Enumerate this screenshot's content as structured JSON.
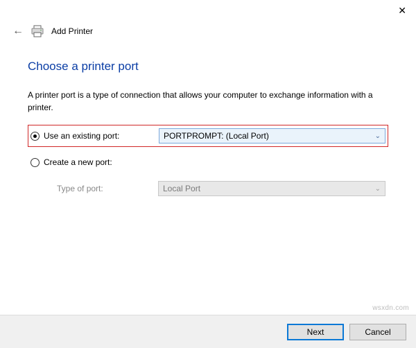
{
  "window": {
    "close_symbol": "✕"
  },
  "header": {
    "back_symbol": "←",
    "title": "Add Printer"
  },
  "content": {
    "heading": "Choose a printer port",
    "description": "A printer port is a type of connection that allows your computer to exchange information with a printer."
  },
  "options": {
    "existing": {
      "label": "Use an existing port:",
      "selected_value": "PORTPROMPT: (Local Port)",
      "checked": true
    },
    "create": {
      "label": "Create a new port:",
      "type_label": "Type of port:",
      "selected_value": "Local Port",
      "checked": false
    }
  },
  "footer": {
    "next": "Next",
    "cancel": "Cancel"
  },
  "watermark": "wsxdn.com"
}
